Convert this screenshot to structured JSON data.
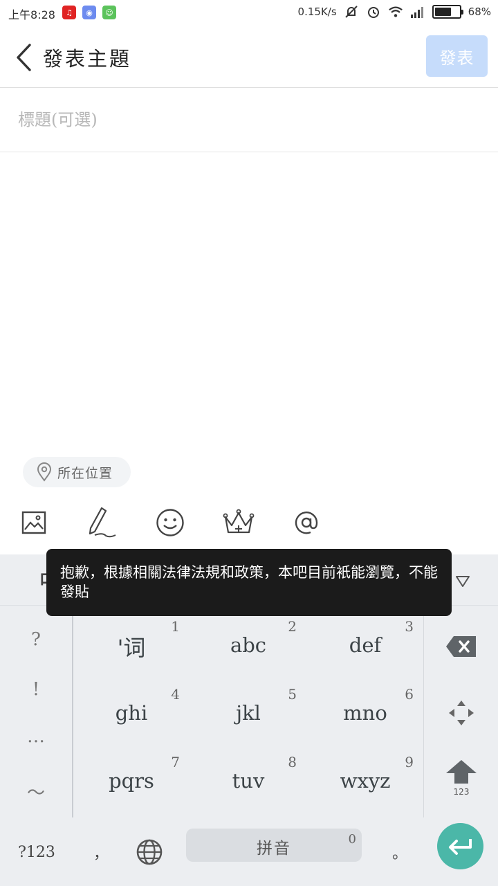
{
  "status_bar": {
    "time": "上午8:28",
    "net_speed": "0.15K/s",
    "battery_pct": "68%",
    "battery_level": 0.68
  },
  "header": {
    "title": "發表主題",
    "post_button": "發表"
  },
  "title_field": {
    "placeholder": "標題(可選)"
  },
  "location": {
    "label": "所在位置"
  },
  "tools": [
    "image-icon",
    "pen-icon",
    "smile-icon",
    "crown-icon",
    "at-icon"
  ],
  "keyboard": {
    "mode": "中",
    "punctuation": [
      "?",
      "!",
      "…",
      "～"
    ],
    "keys": [
      {
        "num": "1",
        "label": "'词"
      },
      {
        "num": "2",
        "label": "abc"
      },
      {
        "num": "3",
        "label": "def"
      },
      {
        "num": "4",
        "label": "ghi"
      },
      {
        "num": "5",
        "label": "jkl"
      },
      {
        "num": "6",
        "label": "mno"
      },
      {
        "num": "7",
        "label": "pqrs"
      },
      {
        "num": "8",
        "label": "tuv"
      },
      {
        "num": "9",
        "label": "wxyz"
      }
    ],
    "shift_sub": "123",
    "bottom": {
      "symbols": "?123",
      "comma": "，",
      "space_label": "拼音",
      "space_num": "0",
      "period": "。"
    }
  },
  "toast": {
    "message": "抱歉，根據相關法律法規和政策，本吧目前衹能瀏覽，不能發貼"
  },
  "colors": {
    "post_button_bg": "#c6dcfb",
    "enter_button": "#4bb7a8",
    "keyboard_bg": "#eceef1",
    "toast_bg": "#1b1b1b"
  }
}
